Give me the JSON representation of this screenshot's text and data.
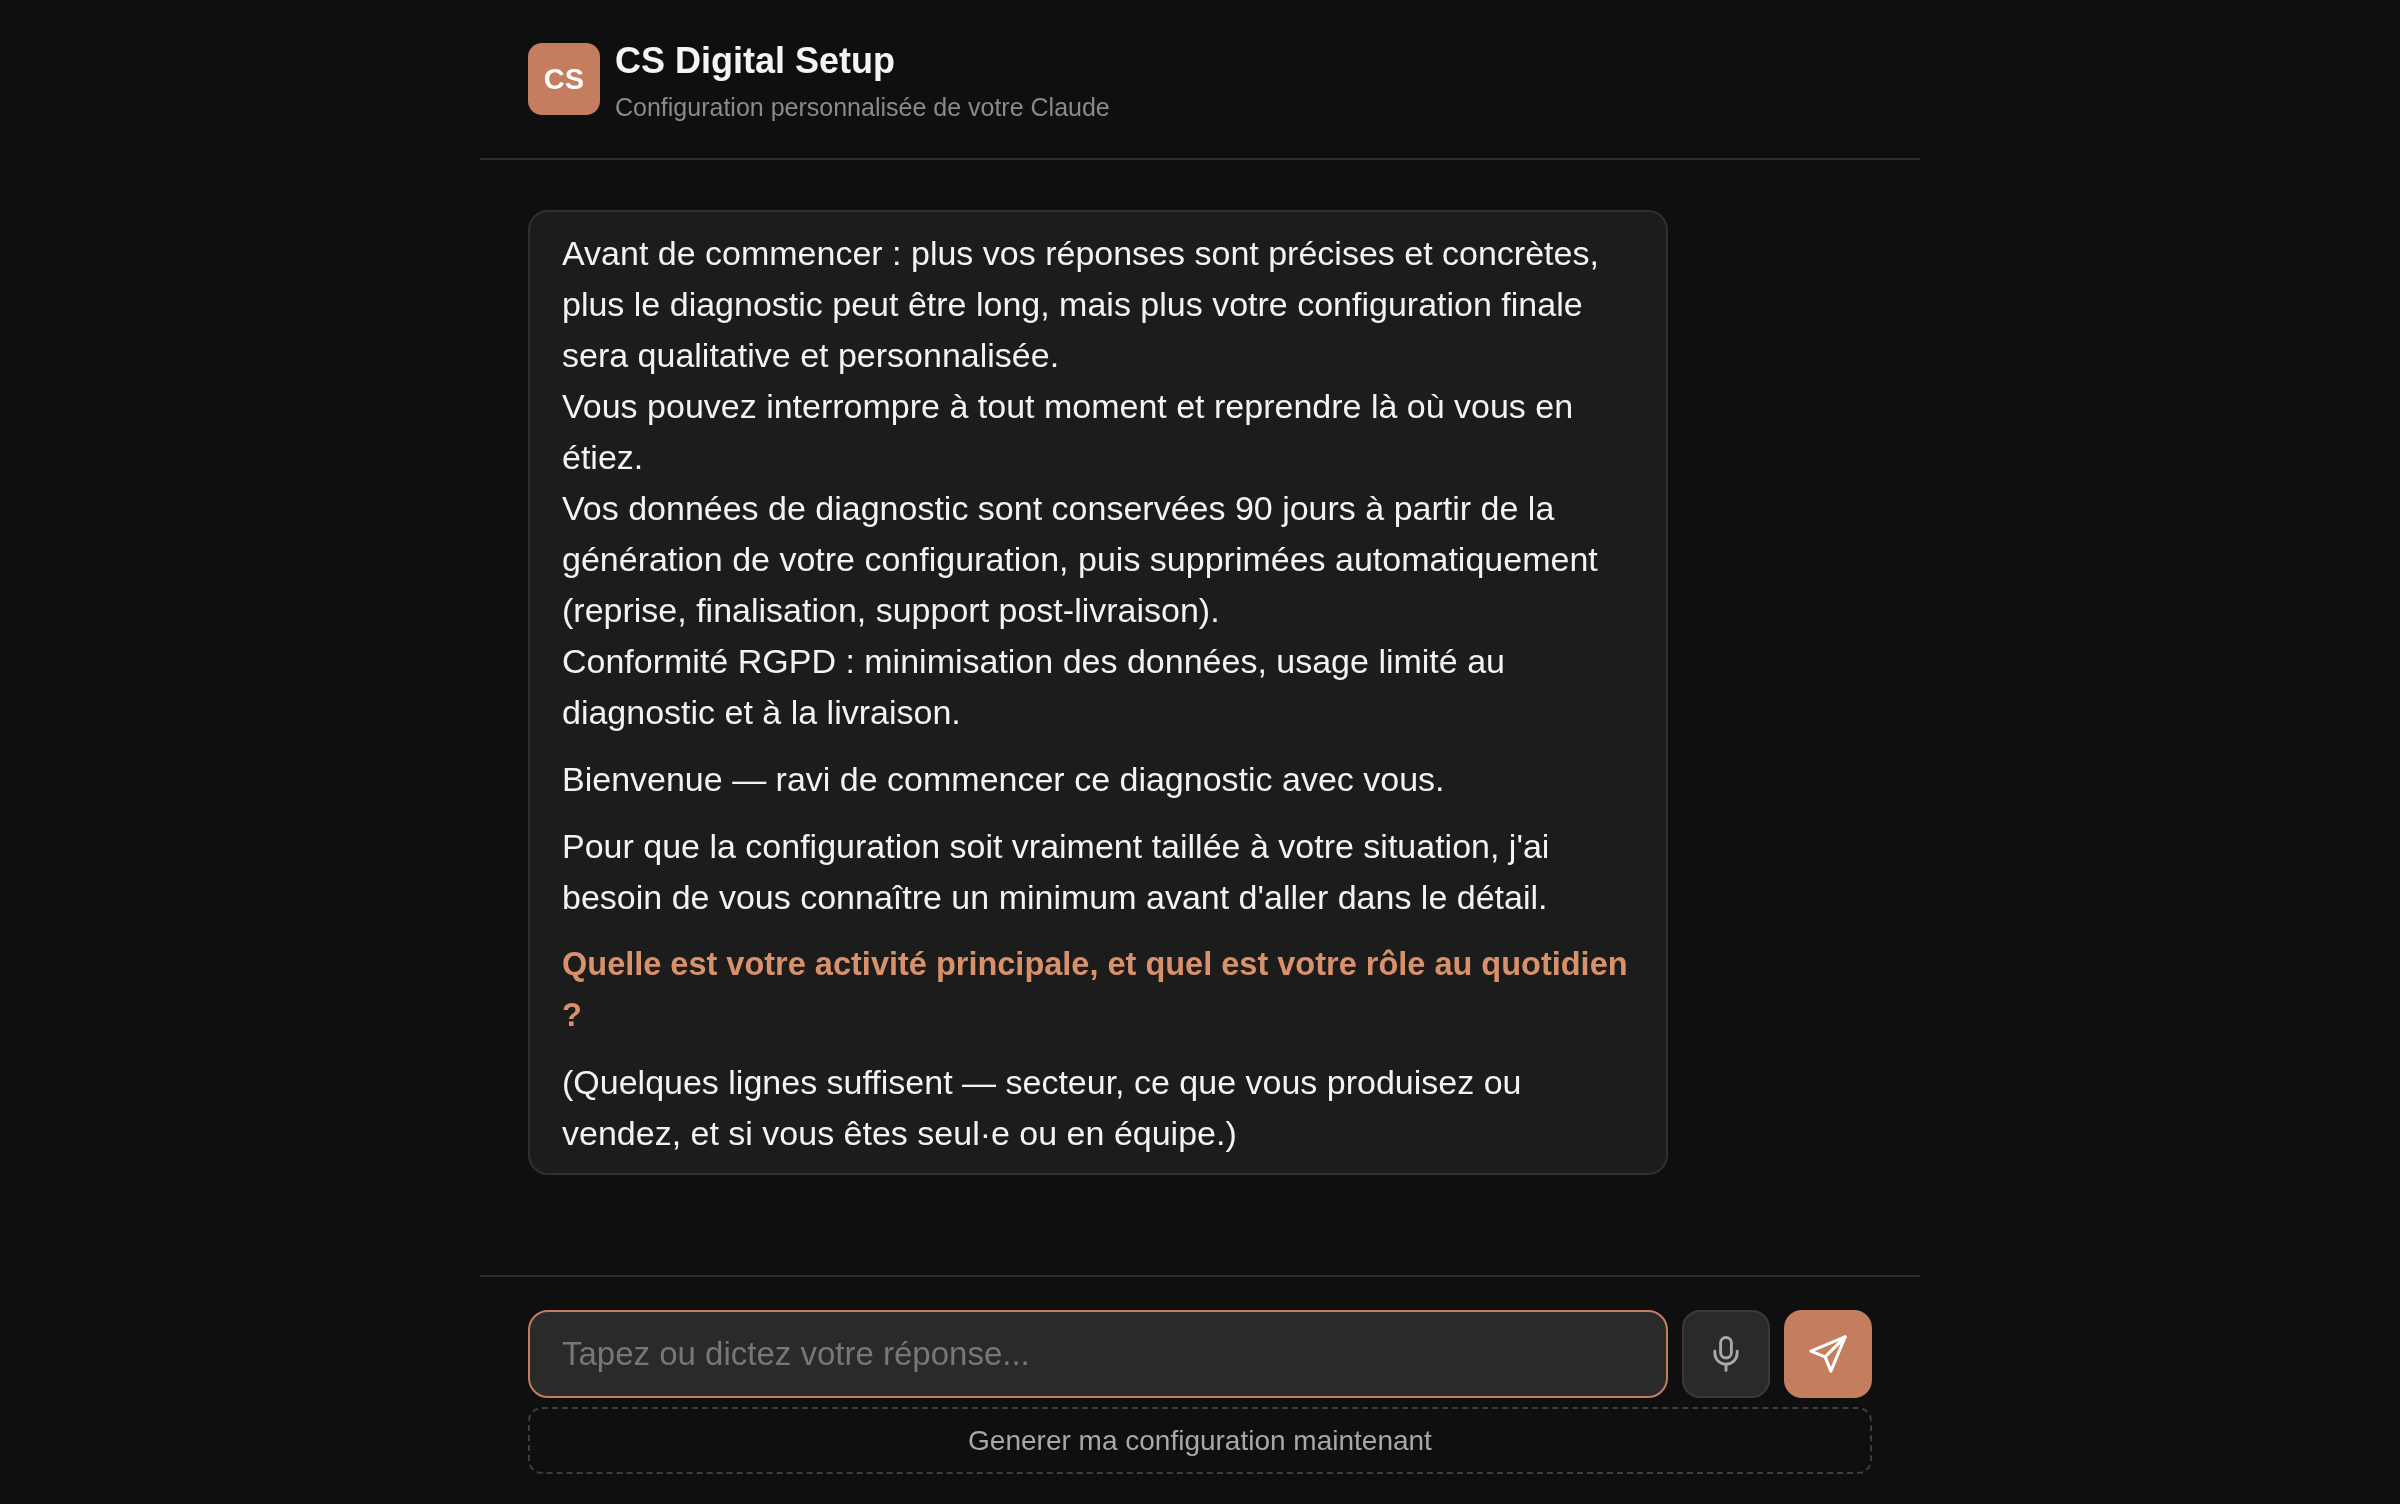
{
  "header": {
    "logo": "CS",
    "title": "CS Digital Setup",
    "subtitle": "Configuration personnalisée de votre Claude"
  },
  "message": {
    "intro_lines": [
      "Avant de commencer : plus vos réponses sont précises et concrètes, plus le diagnostic peut être long, mais plus votre configuration finale sera qualitative et personnalisée.",
      "Vous pouvez interrompre à tout moment et reprendre là où vous en étiez.",
      "Vos données de diagnostic sont conservées 90 jours à partir de la génération de votre configuration, puis supprimées automatiquement (reprise, finalisation, support post-livraison).",
      "Conformité RGPD : minimisation des données, usage limité au diagnostic et à la livraison."
    ],
    "paragraphs": [
      {
        "kind": "text",
        "text": "Bienvenue — ravi de commencer ce diagnostic avec vous."
      },
      {
        "kind": "text",
        "text": "Pour que la configuration soit vraiment taillée à votre situation, j'ai besoin de vous connaître un minimum avant d'aller dans le détail."
      },
      {
        "kind": "question",
        "text": "Quelle est votre activité principale, et quel est votre rôle au quotidien ?"
      },
      {
        "kind": "text",
        "text": "(Quelques lignes suffisent — secteur, ce que vous produisez ou vendez, et si vous êtes seul·e ou en équipe.)"
      }
    ]
  },
  "composer": {
    "placeholder": "Tapez ou dictez votre réponse...",
    "focused": true
  },
  "generate_button": "Generer ma configuration maintenant"
}
